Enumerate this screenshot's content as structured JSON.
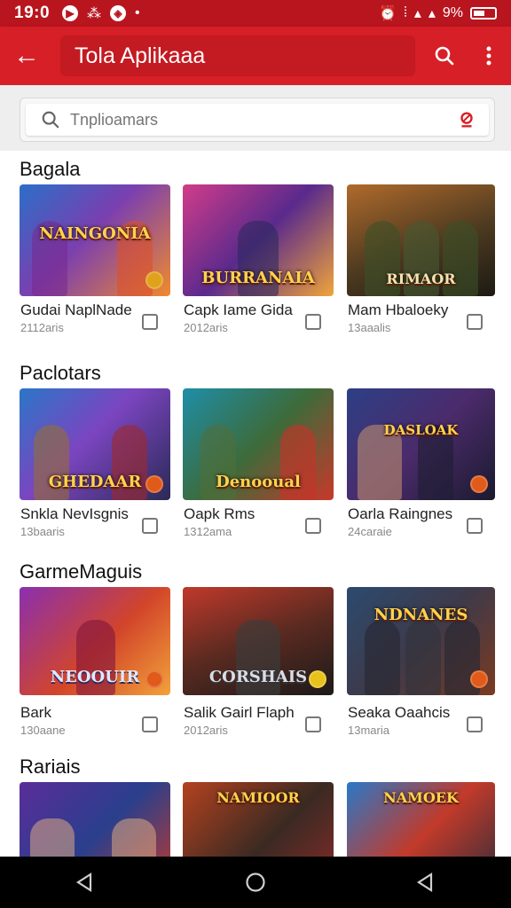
{
  "status": {
    "time": "19:0",
    "battery": "9%"
  },
  "appbar": {
    "title": "Tola Aplikaaa"
  },
  "search": {
    "placeholder": "Tnplioamars"
  },
  "sections": [
    {
      "title": "Bagala",
      "items": [
        {
          "name": "Gudai NaplNade",
          "sub": "2112aris",
          "logo": "NAINGONIA"
        },
        {
          "name": "Capk Iame Gida",
          "sub": "2012aris",
          "logo": "BURRANAIA"
        },
        {
          "name": "Mam Hbaloeky",
          "sub": "13aaalis",
          "logo": "RIMAOR"
        }
      ]
    },
    {
      "title": "Paclotars",
      "items": [
        {
          "name": "Snkla NevIsgnis",
          "sub": "13baaris",
          "logo": "GHEDAAR"
        },
        {
          "name": "Oapk Rms",
          "sub": "1312ama",
          "logo": "Denooual"
        },
        {
          "name": "Oarla Raingnes",
          "sub": "24caraie",
          "logo": "DASLOAK"
        }
      ]
    },
    {
      "title": "GarmeMaguis",
      "items": [
        {
          "name": "Bark",
          "sub": "130aane",
          "logo": "NEOOUIR"
        },
        {
          "name": "Salik Gairl Flaph",
          "sub": "2012aris",
          "logo": "CORSHAIS"
        },
        {
          "name": "Seaka Oaahcis",
          "sub": "13maria",
          "logo": "NDNANES"
        }
      ]
    },
    {
      "title": "Rariais",
      "items": [
        {
          "name": "",
          "sub": "",
          "logo": ""
        },
        {
          "name": "",
          "sub": "",
          "logo": "NAMIOOR"
        },
        {
          "name": "",
          "sub": "",
          "logo": "NAMOEK"
        }
      ]
    }
  ],
  "icons": {
    "back": "arrow-back-icon",
    "search": "search-icon",
    "more": "more-vert-icon",
    "clear": "clear-icon",
    "nav_back": "nav-back-icon",
    "nav_home": "nav-home-icon",
    "nav_recent": "nav-recent-icon"
  },
  "colors": {
    "appbar": "#d71f27",
    "statusbar": "#b8151f",
    "accent": "#d71f27"
  }
}
